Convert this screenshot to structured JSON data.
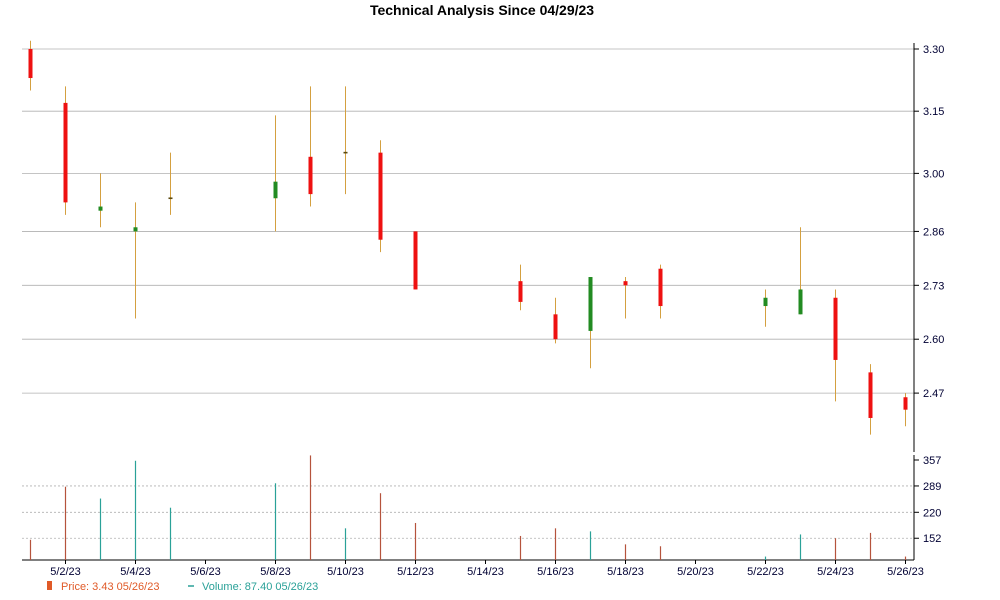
{
  "chart_data": {
    "type": "candlestick",
    "title": "Technical Analysis Since 04/29/23",
    "colors": {
      "up": "#228B22",
      "down": "#ee1111",
      "wick": "#d4a040",
      "volume_up": "#2aa198",
      "volume_down": "#b5533c",
      "grid": "#b0b0b0",
      "axis": "#000000",
      "price_legend": "#e05a28",
      "volume_legend": "#2aa198"
    },
    "price_axis": {
      "ylim": [
        2.34,
        3.3
      ],
      "ticks": [
        2.47,
        2.6,
        2.73,
        2.86,
        3.0,
        3.15,
        3.3
      ],
      "tick_labels": [
        "2.47",
        "2.60",
        "2.73",
        "2.86",
        "3.00",
        "3.15",
        "3.30"
      ]
    },
    "volume_axis": {
      "ylim": [
        95,
        357
      ],
      "ticks": [
        152,
        220,
        289,
        357
      ],
      "tick_labels": [
        "152",
        "220",
        "289",
        "357"
      ]
    },
    "x_axis": {
      "ticks": [
        "5/2/23",
        "5/4/23",
        "5/6/23",
        "5/8/23",
        "5/10/23",
        "5/12/23",
        "5/14/23",
        "5/16/23",
        "5/18/23",
        "5/20/23",
        "5/22/23",
        "5/24/23",
        "5/26/23"
      ]
    },
    "candles": [
      {
        "date": "5/1/23",
        "open": 3.3,
        "high": 3.32,
        "low": 3.2,
        "close": 3.23,
        "volume": 148
      },
      {
        "date": "5/2/23",
        "open": 3.17,
        "high": 3.21,
        "low": 2.9,
        "close": 2.93,
        "volume": 287
      },
      {
        "date": "5/3/23",
        "open": 2.91,
        "high": 3.0,
        "low": 2.87,
        "close": 2.92,
        "volume": 256
      },
      {
        "date": "5/4/23",
        "open": 2.86,
        "high": 2.93,
        "low": 2.65,
        "close": 2.87,
        "volume": 355
      },
      {
        "date": "5/5/23",
        "open": 2.94,
        "high": 3.05,
        "low": 2.9,
        "close": 2.94,
        "volume": 232
      },
      {
        "date": "5/8/23",
        "open": 2.94,
        "high": 3.14,
        "low": 2.86,
        "close": 2.98,
        "volume": 296
      },
      {
        "date": "5/9/23",
        "open": 3.04,
        "high": 3.21,
        "low": 2.92,
        "close": 2.95,
        "volume": 369
      },
      {
        "date": "5/10/23",
        "open": 3.05,
        "high": 3.21,
        "low": 2.95,
        "close": 3.05,
        "volume": 178
      },
      {
        "date": "5/11/23",
        "open": 3.05,
        "high": 3.08,
        "low": 2.81,
        "close": 2.84,
        "volume": 270
      },
      {
        "date": "5/12/23",
        "open": 2.86,
        "high": 2.86,
        "low": 2.72,
        "close": 2.72,
        "volume": 192
      },
      {
        "date": "5/15/23",
        "open": 2.74,
        "high": 2.78,
        "low": 2.67,
        "close": 2.69,
        "volume": 158
      },
      {
        "date": "5/16/23",
        "open": 2.66,
        "high": 2.7,
        "low": 2.59,
        "close": 2.6,
        "volume": 178
      },
      {
        "date": "5/17/23",
        "open": 2.62,
        "high": 2.75,
        "low": 2.53,
        "close": 2.75,
        "volume": 170
      },
      {
        "date": "5/18/23",
        "open": 2.74,
        "high": 2.75,
        "low": 2.65,
        "close": 2.73,
        "volume": 136
      },
      {
        "date": "5/19/23",
        "open": 2.77,
        "high": 2.78,
        "low": 2.65,
        "close": 2.68,
        "volume": 131
      },
      {
        "date": "5/22/23",
        "open": 2.68,
        "high": 2.72,
        "low": 2.63,
        "close": 2.7,
        "volume": 104
      },
      {
        "date": "5/23/23",
        "open": 2.66,
        "high": 2.87,
        "low": 2.66,
        "close": 2.72,
        "volume": 162
      },
      {
        "date": "5/24/23",
        "open": 2.7,
        "high": 2.72,
        "low": 2.45,
        "close": 2.55,
        "volume": 152
      },
      {
        "date": "5/25/23",
        "open": 2.52,
        "high": 2.54,
        "low": 2.37,
        "close": 2.41,
        "volume": 166
      },
      {
        "date": "5/26/23",
        "open": 2.46,
        "high": 2.47,
        "low": 2.39,
        "close": 2.43,
        "volume": 104
      }
    ],
    "legend": {
      "price_label": "Price: 3.43  05/26/23",
      "volume_label": "Volume: 87.40  05/26/23",
      "position": "bottom-left"
    }
  }
}
